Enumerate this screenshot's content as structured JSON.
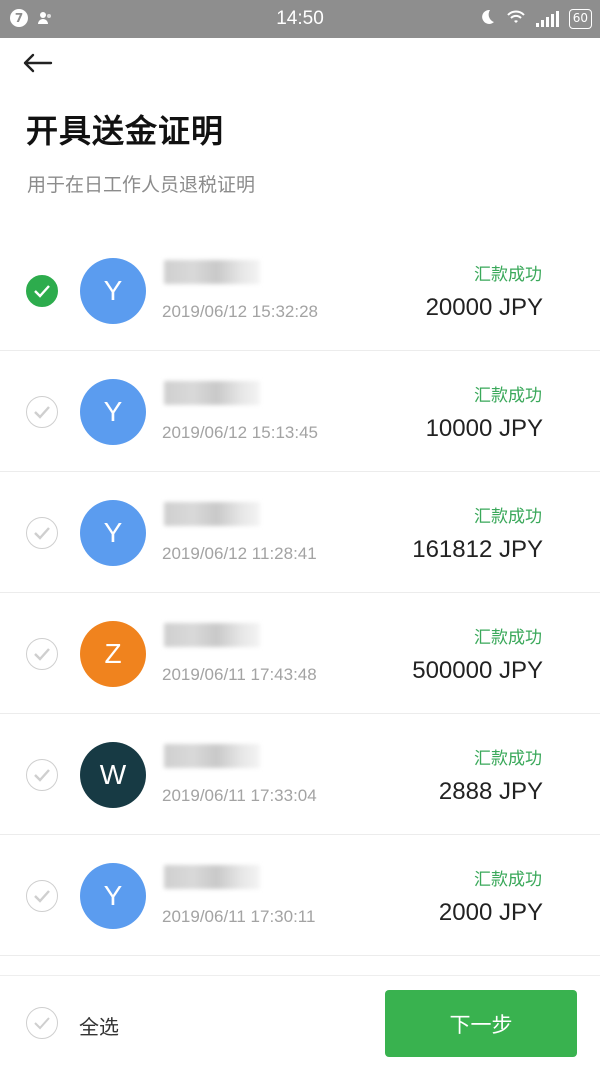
{
  "status_bar": {
    "time": "14:50",
    "notification_count": "7",
    "battery": "60"
  },
  "header": {
    "title": "开具送金证明",
    "subtitle": "用于在日工作人员退税证明"
  },
  "transactions": [
    {
      "avatar_letter": "Y",
      "avatar_color": "#5b9cef",
      "date": "2019/06/12 15:32:28",
      "status": "汇款成功",
      "amount": "20000 JPY",
      "checked": true
    },
    {
      "avatar_letter": "Y",
      "avatar_color": "#5b9cef",
      "date": "2019/06/12 15:13:45",
      "status": "汇款成功",
      "amount": "10000 JPY",
      "checked": false
    },
    {
      "avatar_letter": "Y",
      "avatar_color": "#5b9cef",
      "date": "2019/06/12 11:28:41",
      "status": "汇款成功",
      "amount": "161812 JPY",
      "checked": false
    },
    {
      "avatar_letter": "Z",
      "avatar_color": "#f0831e",
      "date": "2019/06/11 17:43:48",
      "status": "汇款成功",
      "amount": "500000 JPY",
      "checked": false
    },
    {
      "avatar_letter": "W",
      "avatar_color": "#173a44",
      "date": "2019/06/11 17:33:04",
      "status": "汇款成功",
      "amount": "2888 JPY",
      "checked": false
    },
    {
      "avatar_letter": "Y",
      "avatar_color": "#5b9cef",
      "date": "2019/06/11 17:30:11",
      "status": "汇款成功",
      "amount": "2000 JPY",
      "checked": false
    }
  ],
  "footer": {
    "select_all_label": "全选",
    "next_label": "下一步"
  },
  "colors": {
    "accent": "#39b24f",
    "status_green": "#3aa85a"
  }
}
